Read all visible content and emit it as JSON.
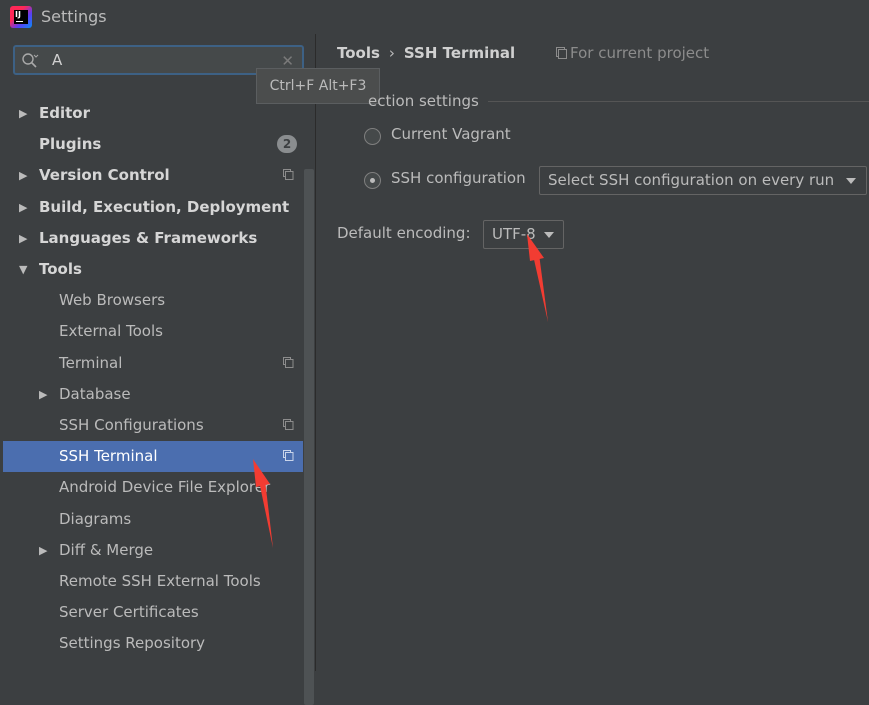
{
  "window": {
    "title": "Settings"
  },
  "search": {
    "value": "A"
  },
  "tooltip": {
    "text": "Ctrl+F Alt+F3"
  },
  "tree": [
    {
      "label": "Editor",
      "bold": true,
      "arrow": "right",
      "indent": 0,
      "top": 0
    },
    {
      "label": "Plugins",
      "bold": true,
      "arrow": "",
      "indent": 0,
      "badge": "2"
    },
    {
      "label": "Version Control",
      "bold": true,
      "arrow": "right",
      "indent": 0,
      "copy": true
    },
    {
      "label": "Build, Execution, Deployment",
      "bold": true,
      "arrow": "right",
      "indent": 0
    },
    {
      "label": "Languages & Frameworks",
      "bold": true,
      "arrow": "right",
      "indent": 0
    },
    {
      "label": "Tools",
      "bold": true,
      "arrow": "down",
      "indent": 0
    },
    {
      "label": "Web Browsers",
      "bold": false,
      "arrow": "",
      "indent": 1
    },
    {
      "label": "External Tools",
      "bold": false,
      "arrow": "",
      "indent": 1
    },
    {
      "label": "Terminal",
      "bold": false,
      "arrow": "",
      "indent": 1,
      "copy": true
    },
    {
      "label": "Database",
      "bold": false,
      "arrow": "right",
      "indent": 1
    },
    {
      "label": "SSH Configurations",
      "bold": false,
      "arrow": "",
      "indent": 1,
      "copy": true
    },
    {
      "label": "SSH Terminal",
      "bold": false,
      "arrow": "",
      "indent": 1,
      "copy": true,
      "selected": true
    },
    {
      "label": "Android Device File Explorer",
      "bold": false,
      "arrow": "",
      "indent": 1
    },
    {
      "label": "Diagrams",
      "bold": false,
      "arrow": "",
      "indent": 1
    },
    {
      "label": "Diff & Merge",
      "bold": false,
      "arrow": "right",
      "indent": 1
    },
    {
      "label": "Remote SSH External Tools",
      "bold": false,
      "arrow": "",
      "indent": 1
    },
    {
      "label": "Server Certificates",
      "bold": false,
      "arrow": "",
      "indent": 1
    },
    {
      "label": "Settings Repository",
      "bold": false,
      "arrow": "",
      "indent": 1
    }
  ],
  "breadcrumb": {
    "parent": "Tools",
    "separator": "›",
    "current": "SSH Terminal"
  },
  "scope": {
    "label": "For current project"
  },
  "connection": {
    "section_title": "ection settings",
    "vagrant_label": "Current Vagrant",
    "ssh_label": "SSH configuration",
    "ssh_select_value": "Select SSH configuration on every run"
  },
  "encoding": {
    "label": "Default encoding:",
    "value": "UTF-8"
  },
  "colors": {
    "selection": "#4b6eaf",
    "annotation_arrow": "#f23c32",
    "background": "#3c3f41"
  }
}
